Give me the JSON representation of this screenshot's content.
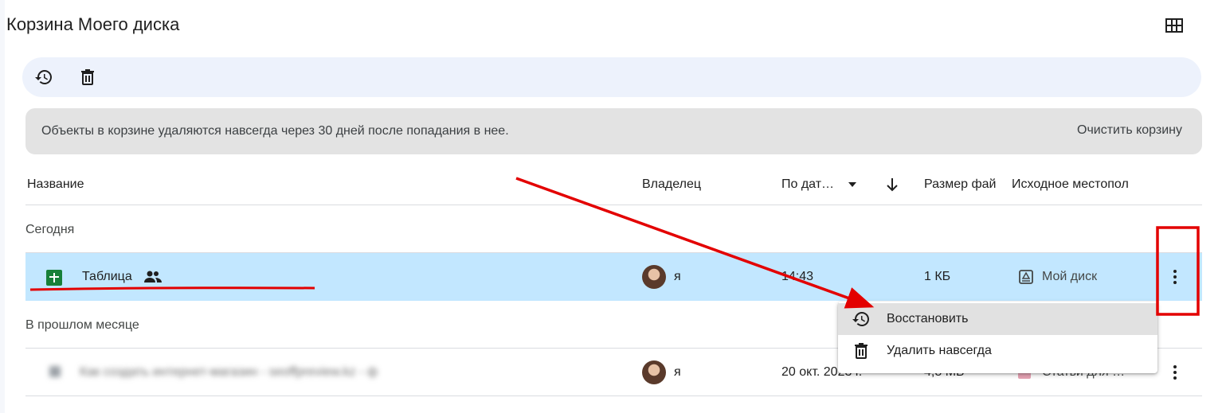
{
  "page": {
    "title": "Корзина Моего диска"
  },
  "toolbar": {
    "restore_icon": "restore-history-icon",
    "delete_icon": "trash-icon",
    "view_icon": "grid-view-icon"
  },
  "banner": {
    "text": "Объекты в корзине удаляются навсегда через 30 дней после попадания в нее.",
    "empty_button": "Очистить корзину"
  },
  "columns": {
    "name": "Название",
    "owner": "Владелец",
    "date": "По дат…",
    "size": "Размер фай",
    "location": "Исходное местопол"
  },
  "groups": [
    {
      "label": "Сегодня",
      "rows": [
        {
          "name": "Таблица",
          "owner": "я",
          "date": "14:43",
          "size": "1 КБ",
          "location": "Мой диск",
          "file_icon": "google-sheets-icon",
          "shared_icon": "people-icon",
          "selected": true
        }
      ]
    },
    {
      "label": "В прошлом месяце",
      "rows": [
        {
          "name": "Как создать интернет-магазин - seoffpreview.kz - ф",
          "owner": "я",
          "date": "20 окт. 2023 г.",
          "size": "4,8 МБ",
          "location": "Статьи для …",
          "blurred": true
        }
      ]
    }
  ],
  "context_menu": {
    "items": [
      {
        "label": "Восстановить",
        "icon": "restore-history-icon"
      },
      {
        "label": "Удалить навсегда",
        "icon": "trash-icon"
      }
    ]
  },
  "colors": {
    "selected_row": "#c2e7ff",
    "toolbar_bg": "#edf2fc",
    "banner_bg": "#e3e3e3",
    "annotation_red": "#e30000",
    "sheets_green": "#188038"
  }
}
